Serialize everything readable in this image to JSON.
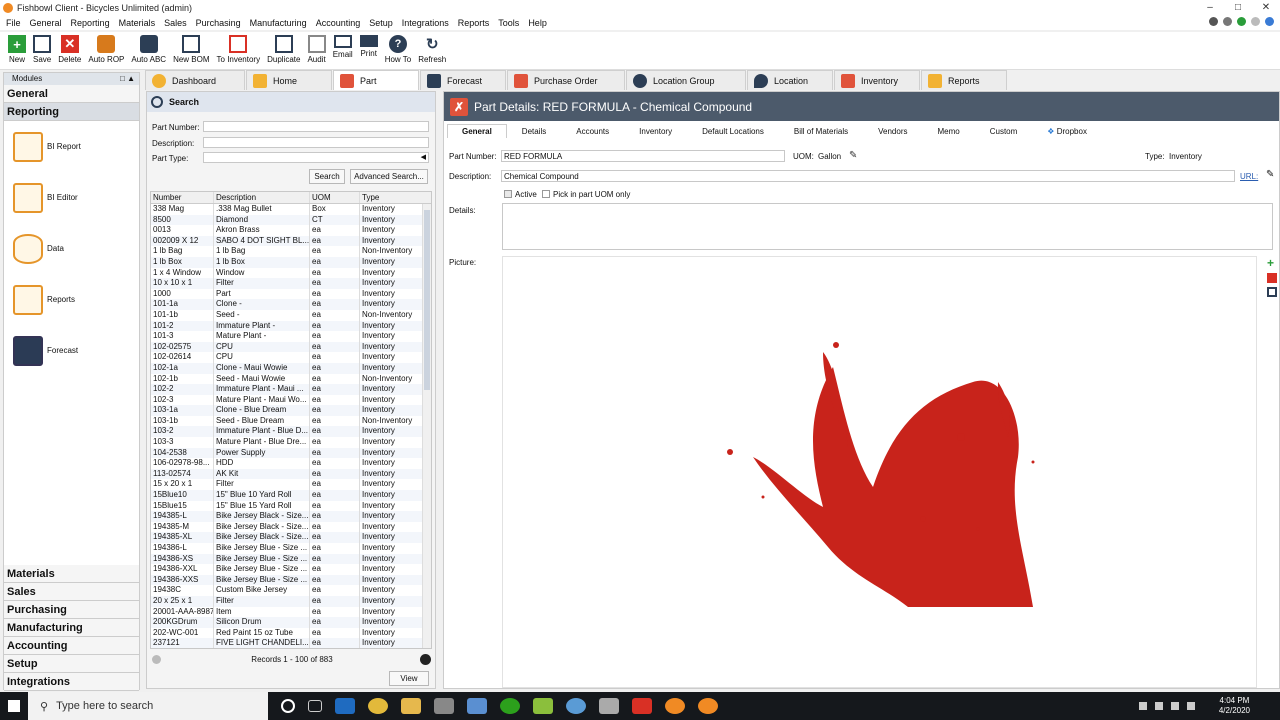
{
  "window": {
    "title": "Fishbowl Client - Bicycles Unlimited (admin)"
  },
  "menu": [
    "File",
    "General",
    "Reporting",
    "Materials",
    "Sales",
    "Purchasing",
    "Manufacturing",
    "Accounting",
    "Setup",
    "Integrations",
    "Reports",
    "Tools",
    "Help"
  ],
  "toolbar": [
    {
      "label": "New",
      "icon": "plus-icon",
      "color": "#2a9d3a"
    },
    {
      "label": "Save",
      "icon": "save-icon",
      "color": "#2c3e55"
    },
    {
      "label": "Delete",
      "icon": "delete-icon",
      "color": "#d93025"
    },
    {
      "label": "Auto ROP",
      "icon": "auto-rop-icon",
      "color": "#d77a1c"
    },
    {
      "label": "Auto ABC",
      "icon": "auto-abc-icon",
      "color": "#2c3e55"
    },
    {
      "label": "New BOM",
      "icon": "new-bom-icon",
      "color": "#2c3e55"
    },
    {
      "label": "To Inventory",
      "icon": "to-inventory-icon",
      "color": "#d93025"
    },
    {
      "label": "Duplicate",
      "icon": "duplicate-icon",
      "color": "#2c3e55"
    },
    {
      "label": "Audit",
      "icon": "audit-icon",
      "color": "#777777"
    },
    {
      "label": "Email",
      "icon": "email-icon",
      "color": "#2c3e55"
    },
    {
      "label": "Print",
      "icon": "print-icon",
      "color": "#2c3e55"
    },
    {
      "label": "How To",
      "icon": "help-icon",
      "color": "#2c3e55"
    },
    {
      "label": "Refresh",
      "icon": "refresh-icon",
      "color": "#2c3e55"
    }
  ],
  "modules": {
    "header": "Modules",
    "sections_top": [
      "General",
      "Reporting"
    ],
    "items": [
      {
        "label": "BI Report",
        "icon": "bi-report-icon"
      },
      {
        "label": "BI Editor",
        "icon": "bi-editor-icon"
      },
      {
        "label": "Data",
        "icon": "data-icon"
      },
      {
        "label": "Reports",
        "icon": "reports-icon"
      },
      {
        "label": "Forecast",
        "icon": "forecast-icon"
      }
    ],
    "sections_bottom": [
      "Materials",
      "Sales",
      "Purchasing",
      "Manufacturing",
      "Accounting",
      "Setup",
      "Integrations"
    ]
  },
  "tabs": [
    {
      "label": "Dashboard",
      "icon": "dashboard-icon",
      "color": "#f2b233"
    },
    {
      "label": "Home",
      "icon": "home-icon",
      "color": "#f2b233"
    },
    {
      "label": "Part",
      "icon": "part-icon",
      "color": "#e0533b"
    },
    {
      "label": "Forecast",
      "icon": "forecast-icon",
      "color": "#2c3e55"
    },
    {
      "label": "Purchase Order",
      "icon": "purchase-order-icon",
      "color": "#e0533b"
    },
    {
      "label": "Location Group",
      "icon": "location-group-icon",
      "color": "#2c3e55"
    },
    {
      "label": "Location",
      "icon": "location-icon",
      "color": "#2c3e55"
    },
    {
      "label": "Inventory",
      "icon": "inventory-icon",
      "color": "#e0533b"
    },
    {
      "label": "Reports",
      "icon": "reports-icon",
      "color": "#f2b233"
    }
  ],
  "search": {
    "title": "Search",
    "fields": [
      "Part Number:",
      "Description:",
      "Part Type:"
    ],
    "search_button": "Search",
    "advanced_button": "Advanced Search...",
    "columns": [
      "Number",
      "Description",
      "UOM",
      "Type"
    ],
    "rows": [
      [
        "338 Mag",
        ".338 Mag Bullet",
        "Box",
        "Inventory"
      ],
      [
        "8500",
        "Diamond",
        "CT",
        "Inventory"
      ],
      [
        "0013",
        "Akron Brass",
        "ea",
        "Inventory"
      ],
      [
        "002009 X 12",
        "SABO 4 DOT SIGHT BL...",
        "ea",
        "Inventory"
      ],
      [
        "1 lb Bag",
        "1 lb Bag",
        "ea",
        "Non-Inventory"
      ],
      [
        "1 lb Box",
        "1 lb Box",
        "ea",
        "Inventory"
      ],
      [
        "1 x 4 Window",
        "Window",
        "ea",
        "Inventory"
      ],
      [
        "10 x 10 x 1",
        "Filter",
        "ea",
        "Inventory"
      ],
      [
        "1000",
        "Part",
        "ea",
        "Inventory"
      ],
      [
        "101-1a",
        "Clone -",
        "ea",
        "Inventory"
      ],
      [
        "101-1b",
        "Seed -",
        "ea",
        "Non-Inventory"
      ],
      [
        "101-2",
        "Immature Plant -",
        "ea",
        "Inventory"
      ],
      [
        "101-3",
        "Mature Plant -",
        "ea",
        "Inventory"
      ],
      [
        "102-02575",
        "CPU",
        "ea",
        "Inventory"
      ],
      [
        "102-02614",
        "CPU",
        "ea",
        "Inventory"
      ],
      [
        "102-1a",
        "Clone - Maui Wowie",
        "ea",
        "Inventory"
      ],
      [
        "102-1b",
        "Seed - Maui Wowie",
        "ea",
        "Non-Inventory"
      ],
      [
        "102-2",
        "Immature Plant - Maui ...",
        "ea",
        "Inventory"
      ],
      [
        "102-3",
        "Mature Plant - Maui Wo...",
        "ea",
        "Inventory"
      ],
      [
        "103-1a",
        "Clone - Blue Dream",
        "ea",
        "Inventory"
      ],
      [
        "103-1b",
        "Seed - Blue Dream",
        "ea",
        "Non-Inventory"
      ],
      [
        "103-2",
        "Immature Plant - Blue D...",
        "ea",
        "Inventory"
      ],
      [
        "103-3",
        "Mature Plant - Blue Dre...",
        "ea",
        "Inventory"
      ],
      [
        "104-2538",
        "Power Supply",
        "ea",
        "Inventory"
      ],
      [
        "106-02978-98...",
        "HDD",
        "ea",
        "Inventory"
      ],
      [
        "113-02574",
        "AK Kit",
        "ea",
        "Inventory"
      ],
      [
        "15 x 20 x 1",
        "Filter",
        "ea",
        "Inventory"
      ],
      [
        "15Blue10",
        "15\" Blue 10 Yard Roll",
        "ea",
        "Inventory"
      ],
      [
        "15Blue15",
        "15\" Blue 15 Yard Roll",
        "ea",
        "Inventory"
      ],
      [
        "194385-L",
        "Bike Jersey Black - Size...",
        "ea",
        "Inventory"
      ],
      [
        "194385-M",
        "Bike Jersey Black - Size...",
        "ea",
        "Inventory"
      ],
      [
        "194385-XL",
        "Bike Jersey Black - Size...",
        "ea",
        "Inventory"
      ],
      [
        "194386-L",
        "Bike Jersey Blue - Size ...",
        "ea",
        "Inventory"
      ],
      [
        "194386-XS",
        "Bike Jersey Blue - Size ...",
        "ea",
        "Inventory"
      ],
      [
        "194386-XXL",
        "Bike Jersey Blue - Size ...",
        "ea",
        "Inventory"
      ],
      [
        "194386-XXS",
        "Bike Jersey Blue - Size ...",
        "ea",
        "Inventory"
      ],
      [
        "19438C",
        "Custom Bike Jersey",
        "ea",
        "Inventory"
      ],
      [
        "20 x 25 x 1",
        "Filter",
        "ea",
        "Inventory"
      ],
      [
        "20001-AAA-8987",
        "Item",
        "ea",
        "Inventory"
      ],
      [
        "200KGDrum",
        "Silicon Drum",
        "ea",
        "Inventory"
      ],
      [
        "202-WC-001",
        "Red Paint 15 oz Tube",
        "ea",
        "Inventory"
      ],
      [
        "237121",
        "FIVE LIGHT CHANDELI...",
        "ea",
        "Inventory"
      ]
    ],
    "records": "Records 1 - 100 of 883",
    "view_button": "View"
  },
  "details": {
    "title": "Part Details: RED FORMULA - Chemical Compound",
    "tabs": [
      "General",
      "Details",
      "Accounts",
      "Inventory",
      "Default Locations",
      "Bill of Materials",
      "Vendors",
      "Memo",
      "Custom",
      "Dropbox"
    ],
    "part_number_label": "Part Number:",
    "part_number": "RED FORMULA",
    "uom_label": "UOM:",
    "uom": "Gallon",
    "type_label": "Type:",
    "type": "Inventory",
    "description_label": "Description:",
    "description": "Chemical Compound",
    "url_label": "URL:",
    "active_label": "Active",
    "pick_label": "Pick in part UOM only",
    "details_label": "Details:",
    "picture_label": "Picture:",
    "splash_color": "#c8231b"
  },
  "taskbar": {
    "search_placeholder": "Type here to search",
    "time": "4:04 PM",
    "date": "4/2/2020"
  }
}
